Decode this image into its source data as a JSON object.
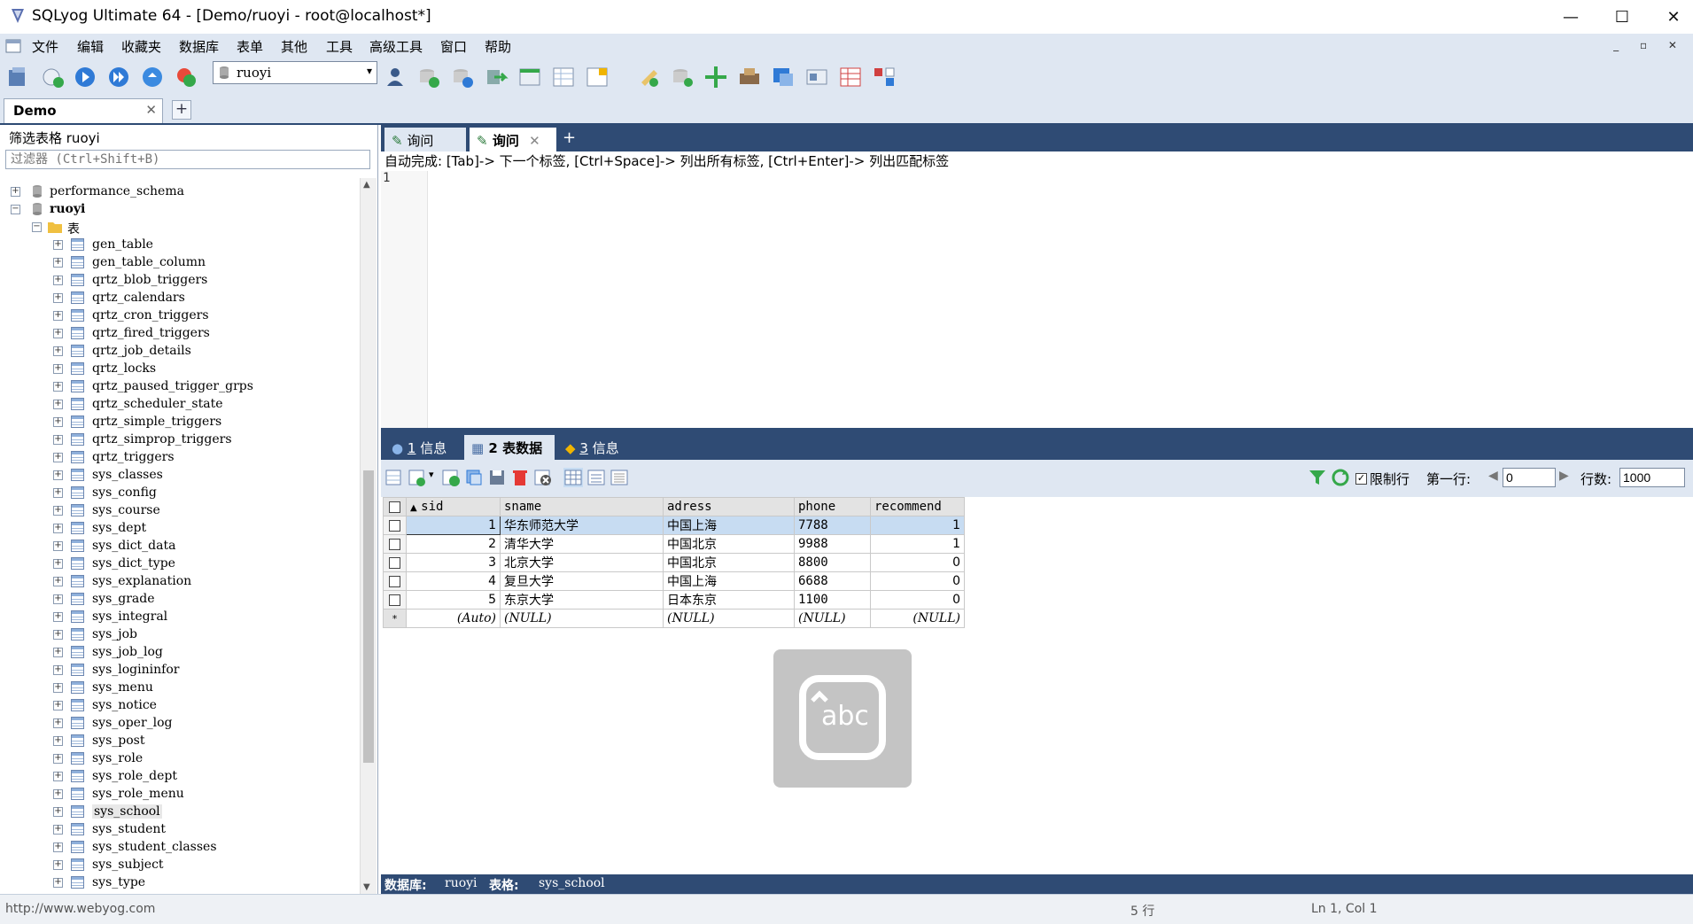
{
  "window": {
    "title": "SQLyog Ultimate 64 - [Demo/ruoyi - root@localhost*]",
    "minimize": "—",
    "maximize": "☐",
    "close": "✕"
  },
  "menu": [
    "文件",
    "编辑",
    "收藏夹",
    "数据库",
    "表单",
    "其他",
    "工具",
    "高级工具",
    "窗口",
    "帮助"
  ],
  "toolbar": {
    "db_selected": "ruoyi"
  },
  "connection_tab": {
    "label": "Demo",
    "close": "✕",
    "add": "+"
  },
  "left_panel": {
    "filter_label": "筛选表格 ruoyi",
    "filter_placeholder": "过滤器 (Ctrl+Shift+B)",
    "databases": [
      {
        "name": "performance_schema",
        "expanded": false
      },
      {
        "name": "ruoyi",
        "expanded": true
      }
    ],
    "folder_label": "表",
    "tables": [
      "gen_table",
      "gen_table_column",
      "qrtz_blob_triggers",
      "qrtz_calendars",
      "qrtz_cron_triggers",
      "qrtz_fired_triggers",
      "qrtz_job_details",
      "qrtz_locks",
      "qrtz_paused_trigger_grps",
      "qrtz_scheduler_state",
      "qrtz_simple_triggers",
      "qrtz_simprop_triggers",
      "qrtz_triggers",
      "sys_classes",
      "sys_config",
      "sys_course",
      "sys_dept",
      "sys_dict_data",
      "sys_dict_type",
      "sys_explanation",
      "sys_grade",
      "sys_integral",
      "sys_job",
      "sys_job_log",
      "sys_logininfor",
      "sys_menu",
      "sys_notice",
      "sys_oper_log",
      "sys_post",
      "sys_role",
      "sys_role_dept",
      "sys_role_menu",
      "sys_school",
      "sys_student",
      "sys_student_classes",
      "sys_subject",
      "sys_type"
    ],
    "selected_table": "sys_school"
  },
  "query_tabs": [
    {
      "label": "询问",
      "active": false
    },
    {
      "label": "询问",
      "active": true,
      "close": "✕"
    }
  ],
  "query_tab_add": "+",
  "hint": "自动完成: [Tab]-> 下一个标签, [Ctrl+Space]-> 列出所有标签, [Ctrl+Enter]-> 列出匹配标签",
  "editor": {
    "line_number": "1"
  },
  "result_tabs": [
    {
      "num": "1",
      "label": "信息"
    },
    {
      "num": "2",
      "label": "表数据",
      "active": true
    },
    {
      "num": "3",
      "label": "信息"
    }
  ],
  "result_toolbar": {
    "limit_label": "限制行",
    "first_row_label": "第一行:",
    "first_row_value": "0",
    "rows_label": "行数:",
    "rows_value": "1000"
  },
  "grid": {
    "columns": [
      "sid",
      "sname",
      "adress",
      "phone",
      "recommend"
    ],
    "rows": [
      [
        "1",
        "华东师范大学",
        "中国上海",
        "7788",
        "1"
      ],
      [
        "2",
        "清华大学",
        "中国北京",
        "9988",
        "1"
      ],
      [
        "3",
        "北京大学",
        "中国北京",
        "8800",
        "0"
      ],
      [
        "4",
        "复旦大学",
        "中国上海",
        "6688",
        "0"
      ],
      [
        "5",
        "东京大学",
        "日本东京",
        "1100",
        "0"
      ]
    ],
    "new_row": [
      "(Auto)",
      "(NULL)",
      "(NULL)",
      "(NULL)",
      "(NULL)"
    ],
    "new_row_marker": "*"
  },
  "status": {
    "db_label": "数据库:",
    "db_value": "ruoyi",
    "table_label": "表格:",
    "table_value": "sys_school"
  },
  "bottom": {
    "url": "http://www.webyog.com",
    "rows": "5 行",
    "position": "Ln 1, Col 1"
  },
  "overlay": {
    "ime_text": "abc"
  },
  "colors": {
    "dark_blue": "#2f4b74",
    "light_blue": "#dfe7f2",
    "selection": "#c7dcf2"
  }
}
